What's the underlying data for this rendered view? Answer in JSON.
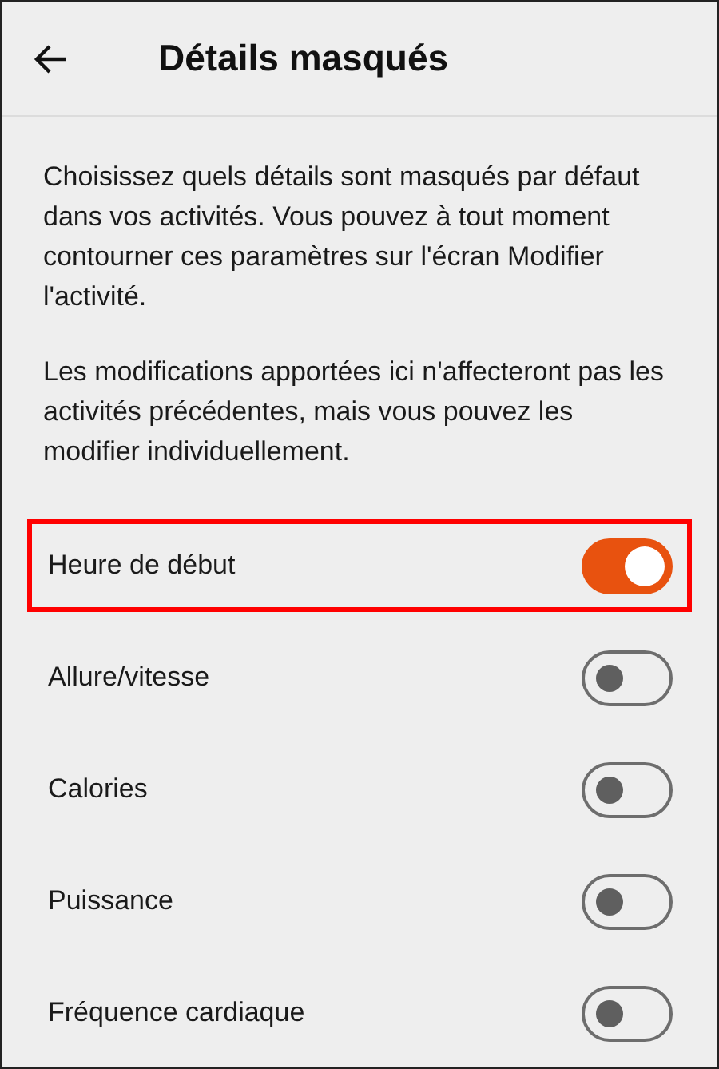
{
  "header": {
    "title": "Détails masqués"
  },
  "intro": [
    "Choisissez quels détails sont masqués par défaut dans vos activités. Vous pouvez à tout moment contourner ces paramètres sur l'écran Modifier l'activité.",
    "Les modifications apportées ici n'affecteront pas les activités précédentes, mais vous pouvez les modifier individuellement."
  ],
  "settings": [
    {
      "label": "Heure de début",
      "on": true,
      "highlighted": true
    },
    {
      "label": "Allure/vitesse",
      "on": false,
      "highlighted": false
    },
    {
      "label": "Calories",
      "on": false,
      "highlighted": false
    },
    {
      "label": "Puissance",
      "on": false,
      "highlighted": false
    },
    {
      "label": "Fréquence cardiaque",
      "on": false,
      "highlighted": false
    }
  ]
}
